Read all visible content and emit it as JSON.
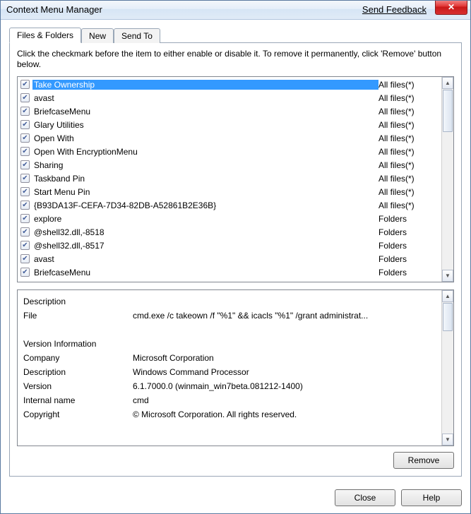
{
  "window": {
    "title": "Context Menu Manager",
    "feedback_link": "Send Feedback"
  },
  "tabs": [
    {
      "label": "Files & Folders",
      "active": true
    },
    {
      "label": "New",
      "active": false
    },
    {
      "label": "Send To",
      "active": false
    }
  ],
  "hint": "Click the checkmark before the item to either enable or disable it. To remove it permanently, click 'Remove' button below.",
  "items": [
    {
      "checked": true,
      "name": "Take Ownership",
      "type": "All files(*)",
      "selected": true
    },
    {
      "checked": true,
      "name": "avast",
      "type": "All files(*)"
    },
    {
      "checked": true,
      "name": "BriefcaseMenu",
      "type": "All files(*)"
    },
    {
      "checked": true,
      "name": "Glary Utilities",
      "type": "All files(*)"
    },
    {
      "checked": true,
      "name": "Open With",
      "type": "All files(*)"
    },
    {
      "checked": true,
      "name": "Open With EncryptionMenu",
      "type": "All files(*)"
    },
    {
      "checked": true,
      "name": "Sharing",
      "type": "All files(*)"
    },
    {
      "checked": true,
      "name": "Taskband Pin",
      "type": "All files(*)"
    },
    {
      "checked": true,
      "name": "Start Menu Pin",
      "type": "All files(*)"
    },
    {
      "checked": true,
      "name": "{B93DA13F-CEFA-7D34-82DB-A52861B2E36B}",
      "type": "All files(*)"
    },
    {
      "checked": true,
      "name": "explore",
      "type": "Folders"
    },
    {
      "checked": true,
      "name": "@shell32.dll,-8518",
      "type": "Folders"
    },
    {
      "checked": true,
      "name": "@shell32.dll,-8517",
      "type": "Folders"
    },
    {
      "checked": true,
      "name": "avast",
      "type": "Folders"
    },
    {
      "checked": true,
      "name": "BriefcaseMenu",
      "type": "Folders"
    }
  ],
  "details": {
    "labels": {
      "description_section": "Description",
      "file": "File",
      "version_section": "Version Information",
      "company": "Company",
      "description": "Description",
      "version": "Version",
      "internal_name": "Internal name",
      "copyright": "Copyright"
    },
    "file": "cmd.exe /c takeown /f \"%1\" && icacls \"%1\" /grant administrat...",
    "company": "Microsoft Corporation",
    "description": "Windows Command Processor",
    "version": "6.1.7000.0 (winmain_win7beta.081212-1400)",
    "internal_name": "cmd",
    "copyright": "© Microsoft Corporation. All rights reserved."
  },
  "buttons": {
    "remove": "Remove",
    "close": "Close",
    "help": "Help"
  }
}
